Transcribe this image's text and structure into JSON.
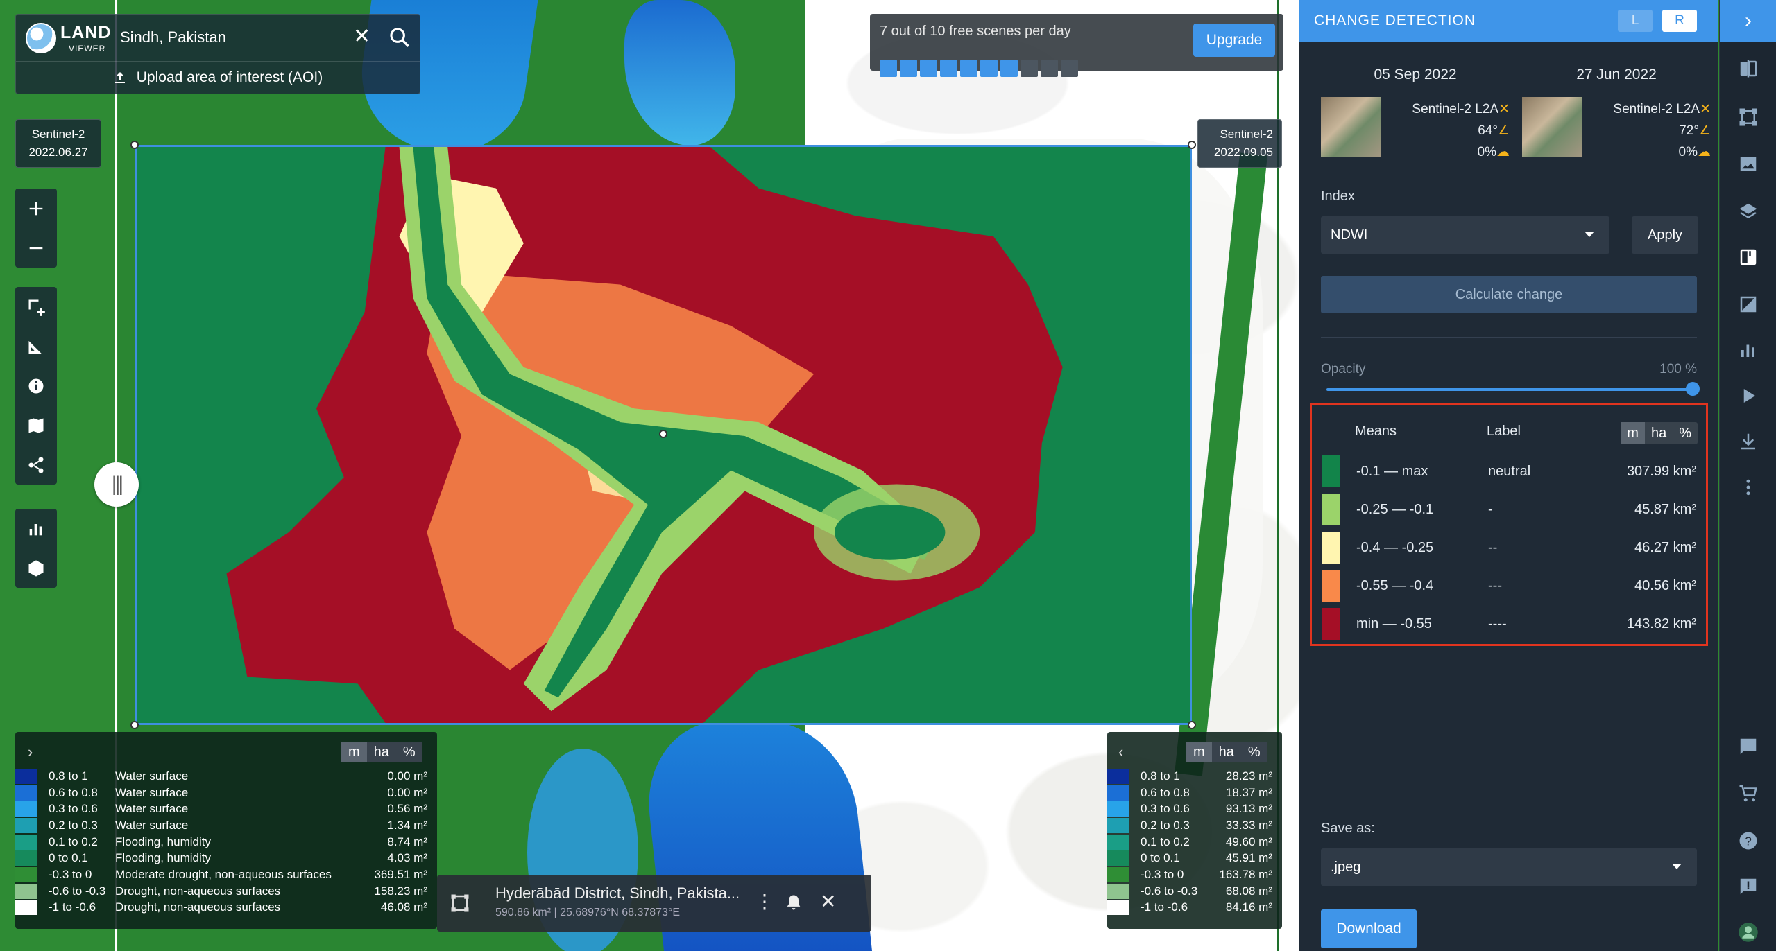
{
  "search": {
    "value": "Sindh, Pakistan",
    "upload_label": "Upload area of interest (AOI)",
    "logo_line1": "LAND",
    "logo_line2": "VIEWER"
  },
  "badges": {
    "left": {
      "sensor": "Sentinel-2",
      "date": "2022.06.27"
    },
    "right": {
      "sensor": "Sentinel-2",
      "date": "2022.09.05"
    }
  },
  "scene_counter": {
    "text": "7 out of 10 free scenes per day",
    "used": 7,
    "total": 10,
    "upgrade_label": "Upgrade"
  },
  "unit_toggle": [
    "m",
    "ha",
    "%"
  ],
  "legend_left": {
    "rows": [
      {
        "range": "0.8 to 1",
        "label": "Water surface",
        "value": "0.00 m²",
        "color": "#0b2e9c"
      },
      {
        "range": "0.6 to 0.8",
        "label": "Water surface",
        "value": "0.00 m²",
        "color": "#1b6fd6"
      },
      {
        "range": "0.3 to 0.6",
        "label": "Water surface",
        "value": "0.56 m²",
        "color": "#28a3e9"
      },
      {
        "range": "0.2 to 0.3",
        "label": "Water surface",
        "value": "1.34 m²",
        "color": "#1e9fb2"
      },
      {
        "range": "0.1 to 0.2",
        "label": "Flooding, humidity",
        "value": "8.74 m²",
        "color": "#1a9e86"
      },
      {
        "range": "0 to 0.1",
        "label": "Flooding, humidity",
        "value": "4.03 m²",
        "color": "#168a5c"
      },
      {
        "range": "-0.3 to 0",
        "label": "Moderate drought, non-aqueous surfaces",
        "value": "369.51 m²",
        "color": "#2f8e35"
      },
      {
        "range": "-0.6 to -0.3",
        "label": "Drought, non-aqueous surfaces",
        "value": "158.23 m²",
        "color": "#8fc48f"
      },
      {
        "range": "-1 to -0.6",
        "label": "Drought, non-aqueous surfaces",
        "value": "46.08 m²",
        "color": "#ffffff"
      }
    ]
  },
  "legend_right": {
    "rows": [
      {
        "range": "0.8 to 1",
        "value": "28.23 m²",
        "color": "#0b2e9c"
      },
      {
        "range": "0.6 to 0.8",
        "value": "18.37 m²",
        "color": "#1b6fd6"
      },
      {
        "range": "0.3 to 0.6",
        "value": "93.13 m²",
        "color": "#28a3e9"
      },
      {
        "range": "0.2 to 0.3",
        "value": "33.33 m²",
        "color": "#1e9fb2"
      },
      {
        "range": "0.1 to 0.2",
        "value": "49.60 m²",
        "color": "#1a9e86"
      },
      {
        "range": "0 to 0.1",
        "value": "45.91 m²",
        "color": "#168a5c"
      },
      {
        "range": "-0.3 to 0",
        "value": "163.78 m²",
        "color": "#2f8e35"
      },
      {
        "range": "-0.6 to -0.3",
        "value": "68.08 m²",
        "color": "#8fc48f"
      },
      {
        "range": "-1 to -0.6",
        "value": "84.16 m²",
        "color": "#ffffff"
      }
    ]
  },
  "aoi_bar": {
    "name": "Hyderābād District, Sindh, Pakista...",
    "meta": "590.86 km² | 25.68976°N 68.37873°E"
  },
  "panel": {
    "title": "CHANGE DETECTION",
    "btn_left": "L",
    "btn_right": "R",
    "scenes": [
      {
        "date": "05 Sep 2022",
        "sensor": "Sentinel-2 L2A",
        "angle": "64°",
        "cloud": "0%"
      },
      {
        "date": "27 Jun 2022",
        "sensor": "Sentinel-2 L2A",
        "angle": "72°",
        "cloud": "0%"
      }
    ],
    "index_label": "Index",
    "index_value": "NDWI",
    "apply_label": "Apply",
    "calc_label": "Calculate change",
    "opacity_label": "Opacity",
    "opacity_value": "100 %",
    "opacity_level": 1.0,
    "stats_headers": {
      "means": "Means",
      "label": "Label"
    },
    "stats": [
      {
        "means": "-0.1 — max",
        "label": "neutral",
        "value": "307.99 km²",
        "color": "#12844a"
      },
      {
        "means": "-0.25 — -0.1",
        "label": "-",
        "value": "45.87 km²",
        "color": "#9bd36a"
      },
      {
        "means": "-0.4 — -0.25",
        "label": "--",
        "value": "46.27 km²",
        "color": "#fff5b0"
      },
      {
        "means": "-0.55 — -0.4",
        "label": "---",
        "value": "40.56 km²",
        "color": "#f9894a"
      },
      {
        "means": "min — -0.55",
        "label": "----",
        "value": "143.82 km²",
        "color": "#a50f26"
      }
    ],
    "save_label": "Save as:",
    "save_value": ".jpeg",
    "download_label": "Download"
  }
}
